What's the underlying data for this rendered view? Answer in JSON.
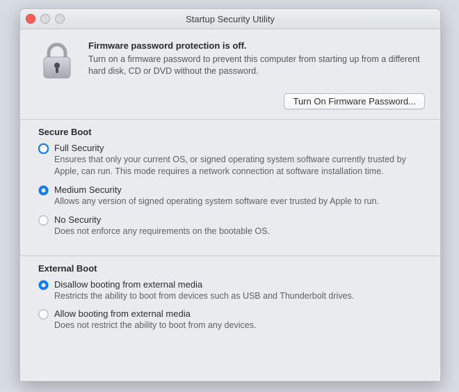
{
  "window": {
    "title": "Startup Security Utility"
  },
  "firmware": {
    "heading": "Firmware password protection is off.",
    "body": "Turn on a firmware password to prevent this computer from starting up from a different hard disk, CD or DVD without the password.",
    "button": "Turn On Firmware Password..."
  },
  "secure_boot": {
    "title": "Secure Boot",
    "options": [
      {
        "label": "Full Security",
        "desc": "Ensures that only your current OS, or signed operating system software currently trusted by Apple, can run. This mode requires a network connection at software installation time.",
        "selected": false,
        "highlighted": true
      },
      {
        "label": "Medium Security",
        "desc": "Allows any version of signed operating system software ever trusted by Apple to run.",
        "selected": true,
        "highlighted": false
      },
      {
        "label": "No Security",
        "desc": "Does not enforce any requirements on the bootable OS.",
        "selected": false,
        "highlighted": false
      }
    ]
  },
  "external_boot": {
    "title": "External Boot",
    "options": [
      {
        "label": "Disallow booting from external media",
        "desc": "Restricts the ability to boot from devices such as USB and Thunderbolt drives.",
        "selected": true
      },
      {
        "label": "Allow booting from external media",
        "desc": "Does not restrict the ability to boot from any devices.",
        "selected": false
      }
    ]
  },
  "colors": {
    "accent": "#0a7aff"
  }
}
